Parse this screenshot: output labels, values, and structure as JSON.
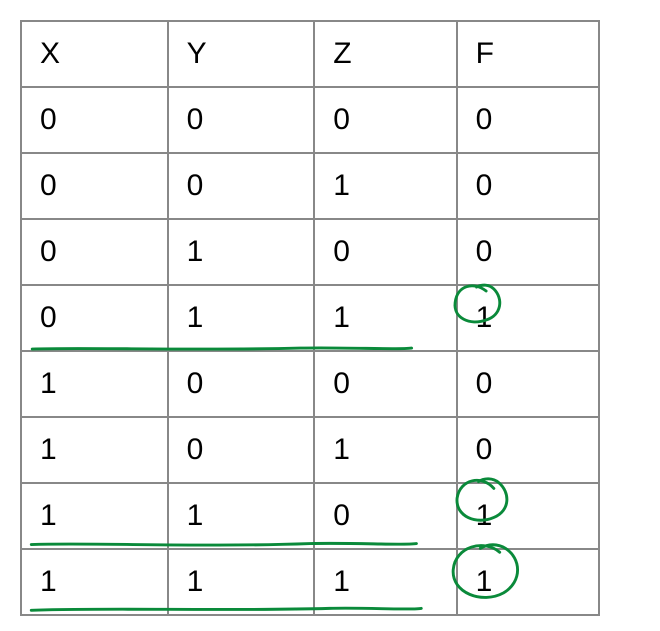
{
  "table": {
    "headers": [
      "X",
      "Y",
      "Z",
      "F"
    ],
    "rows": [
      {
        "X": "0",
        "Y": "0",
        "Z": "0",
        "F": "0"
      },
      {
        "X": "0",
        "Y": "0",
        "Z": "1",
        "F": "0"
      },
      {
        "X": "0",
        "Y": "1",
        "Z": "0",
        "F": "0"
      },
      {
        "X": "0",
        "Y": "1",
        "Z": "1",
        "F": "1"
      },
      {
        "X": "1",
        "Y": "0",
        "Z": "0",
        "F": "0"
      },
      {
        "X": "1",
        "Y": "0",
        "Z": "1",
        "F": "0"
      },
      {
        "X": "1",
        "Y": "1",
        "Z": "0",
        "F": "1"
      },
      {
        "X": "1",
        "Y": "1",
        "Z": "1",
        "F": "1"
      }
    ]
  },
  "annotations": {
    "color": "#0a8a3a",
    "circledRows": [
      3,
      6,
      7
    ],
    "underlinedRows": [
      3,
      6,
      7
    ]
  }
}
